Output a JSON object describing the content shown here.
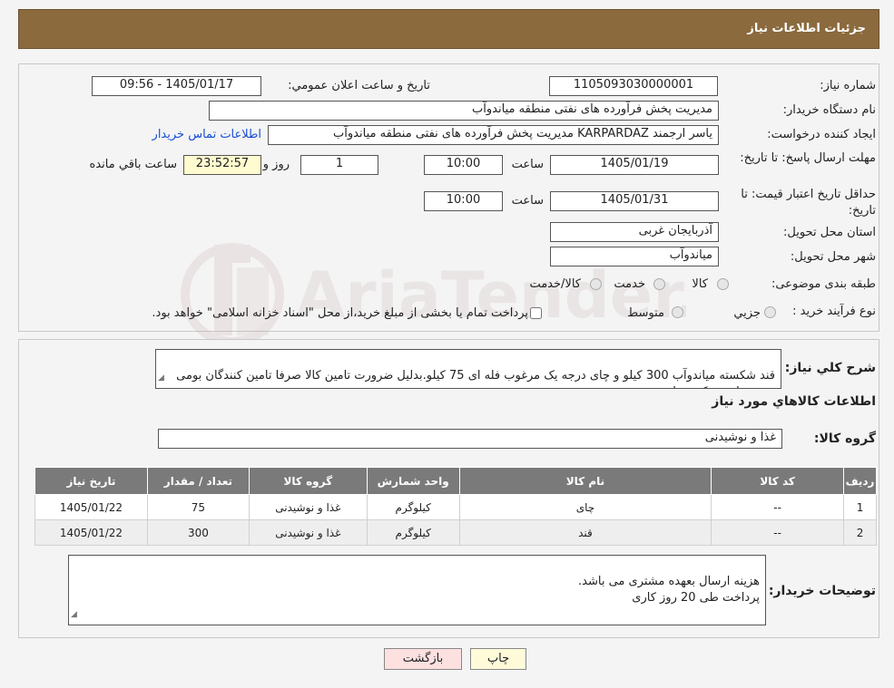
{
  "header": {
    "title": "جزئیات اطلاعات نیاز"
  },
  "watermark": {
    "text": "AriaTender.neT"
  },
  "form": {
    "need_number_label": "شماره نیاز:",
    "need_number": "1105093030000001",
    "announce_label": "تاریخ و ساعت اعلان عمومي:",
    "announce_value": "1405/01/17 - 09:56",
    "buyer_org_label": "نام دستگاه خريدار:",
    "buyer_org": "مدیریت پخش فرآورده های نفتی منطقه میاندوآب",
    "creator_label": "ايجاد کننده درخواست:",
    "creator": "یاسر ارجمند KARPARDAZ مدیریت پخش فرآورده های نفتی منطقه میاندوآب",
    "contact_link": "اطلاعات تماس خریدار",
    "reply_deadline_label": "مهلت ارسال پاسخ: تا تاریخ:",
    "reply_date": "1405/01/19",
    "time_label": "ساعت",
    "reply_time": "10:00",
    "days_value": "1",
    "days_label": "روز و",
    "remaining_time": "23:52:57",
    "remaining_label": "ساعت باقي مانده",
    "price_validity_label": "حداقل تاریخ اعتبار قیمت: تا تاریخ:",
    "price_date": "1405/01/31",
    "price_time": "10:00",
    "province_label": "استان محل تحویل:",
    "province": "آذربایجان غربی",
    "city_label": "شهر محل تحویل:",
    "city": "میاندوآب",
    "category_label": "طبقه بندی موضوعی:",
    "category_options": [
      "کالا",
      "خدمت",
      "کالا/خدمت"
    ],
    "process_label": "نوع فرآیند خرید :",
    "process_options": [
      "جزیي",
      "متوسط"
    ],
    "process_note": "پرداخت تمام یا بخشی از مبلغ خرید،از محل \"اسناد خزانه اسلامی\" خواهد بود."
  },
  "summary": {
    "label": "شرح کلي نياز:",
    "text": "قند شکسته میاندوآب 300 کیلو و چای درجه یک مرغوب فله ای 75 کیلو.بدلیل ضرورت تامین کالا صرفا تامین کنندگان بومی شهرستان شرکت نمایند."
  },
  "goods": {
    "section_title": "اطلاعات کالاهاي مورد نياز",
    "group_label": "گروه کالا:",
    "group_value": "غذا و نوشیدنی",
    "columns": [
      "رديف",
      "کد کالا",
      "نام کالا",
      "واحد شمارش",
      "گروه کالا",
      "تعداد / مقدار",
      "تاریخ نیاز"
    ],
    "rows": [
      [
        "1",
        "--",
        "چای",
        "کیلوگرم",
        "غذا و نوشیدنی",
        "75",
        "1405/01/22"
      ],
      [
        "2",
        "--",
        "قند",
        "کیلوگرم",
        "غذا و نوشیدنی",
        "300",
        "1405/01/22"
      ]
    ]
  },
  "notes": {
    "label": "توضيحات خريدار:",
    "text": "هزینه ارسال بعهده مشتری می باشد.\nپرداخت طی 20 روز کاری"
  },
  "buttons": {
    "print": "چاپ",
    "back": "بازگشت"
  }
}
